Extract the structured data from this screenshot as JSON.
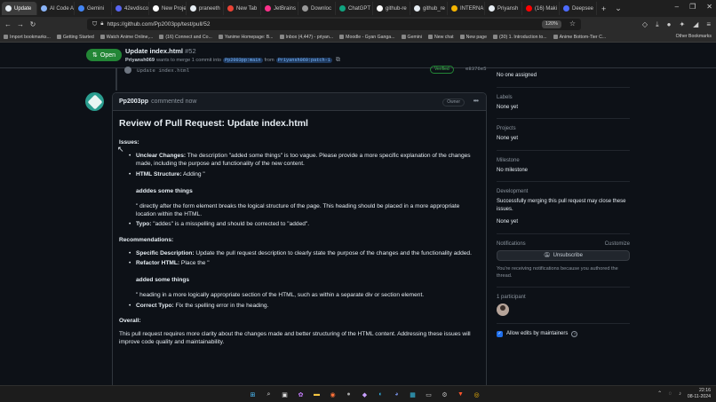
{
  "browser": {
    "tabs": [
      {
        "label": "Update",
        "color": "#e6edf3",
        "active": true
      },
      {
        "label": "AI Code A",
        "color": "#8ab4f8"
      },
      {
        "label": "Gemini",
        "color": "#4285f4"
      },
      {
        "label": "42evdisco",
        "color": "#5865f2"
      },
      {
        "label": "New Proje",
        "color": "#ffffff"
      },
      {
        "label": "praneeth",
        "color": "#e6edf3"
      },
      {
        "label": "New Tab",
        "color": "#ea4335"
      },
      {
        "label": "JetBrains",
        "color": "#ff318c"
      },
      {
        "label": "Downloc",
        "color": "#999999"
      },
      {
        "label": "ChatGPT",
        "color": "#10a37f"
      },
      {
        "label": "github-re",
        "color": "#ffffff"
      },
      {
        "label": "github_re",
        "color": "#e6edf3"
      },
      {
        "label": "INTERNA",
        "color": "#f4b400"
      },
      {
        "label": "Priyansh",
        "color": "#e6edf3"
      },
      {
        "label": "(16) Maki",
        "color": "#ff0000"
      },
      {
        "label": "Deepsee",
        "color": "#4d6bfe"
      }
    ],
    "url": "https://github.com/Pp2003pp/test/pull/52",
    "zoom": "120%",
    "bookmarks": [
      "Import bookmarks...",
      "Getting Started",
      "Watch Anime Online,...",
      "(16) Connect and Co...",
      "Yanime Homepage: B...",
      "Inbox (4,447) - priyan...",
      "Moodle - Gyan Ganga...",
      "Gemini",
      "New chat",
      "New page",
      "(30) 1. Introduction to...",
      "Anime Bottom-Tier C..."
    ],
    "other_bookmarks": "Other Bookmarks"
  },
  "pr": {
    "status": "Open",
    "title": "Update index.html",
    "number": "#52",
    "author": "Priyansh069",
    "action_text": "wants to merge 1 commit into",
    "base_branch": "Pp2003pp:main",
    "from_text": "from",
    "head_branch": "Priyansh069:patch-1"
  },
  "commit": {
    "message": "Update index.html",
    "verified": "Verified",
    "sha": "e8376e5"
  },
  "comment": {
    "author": "Pp2003pp",
    "meta": "commented now",
    "badge": "Owner",
    "heading": "Review of Pull Request: Update index.html",
    "issues_label": "Issues:",
    "issue1_bold": "Unclear Changes:",
    "issue1_text": " The description \"added some things\" is too vague. Please provide a more specific explanation of the changes made, including the purpose and functionality of the new content.",
    "issue2_bold": "HTML Structure:",
    "issue2_text": " Adding \"",
    "issue2_heading": "adddes some things",
    "issue2_cont": "\" directly after the form element breaks the logical structure of the page. This heading should be placed in a more appropriate location within the HTML.",
    "issue3_bold": "Typo:",
    "issue3_text": " \"addes\" is a misspelling and should be corrected to \"added\".",
    "rec_label": "Recommendations:",
    "rec1_bold": "Specific Description:",
    "rec1_text": " Update the pull request description to clearly state the purpose of the changes and the functionality added.",
    "rec2_bold": "Refactor HTML:",
    "rec2_text": " Place the \"",
    "rec2_heading": "added some things",
    "rec2_cont": "\" heading in a more logically appropriate section of the HTML, such as within a separate div or section element.",
    "rec3_bold": "Correct Typo:",
    "rec3_text": " Fix the spelling error in the heading.",
    "overall_label": "Overall:",
    "overall_text": "This pull request requires more clarity about the changes made and better structuring of the HTML content. Addressing these issues will improve code quality and maintainability."
  },
  "sidebar": {
    "assignees_value": "No one assigned",
    "labels_title": "Labels",
    "labels_value": "None yet",
    "projects_title": "Projects",
    "projects_value": "None yet",
    "milestone_title": "Milestone",
    "milestone_value": "No milestone",
    "development_title": "Development",
    "development_text": "Successfully merging this pull request may close these issues.",
    "development_value": "None yet",
    "notifications_title": "Notifications",
    "customize": "Customize",
    "unsubscribe": "Unsubscribe",
    "notify_text": "You're receiving notifications because you authored the thread.",
    "participants_title": "1 participant",
    "allow_edits": "Allow edits by maintainers"
  },
  "taskbar": {
    "time": "22:16",
    "date": "08-11-2024"
  }
}
